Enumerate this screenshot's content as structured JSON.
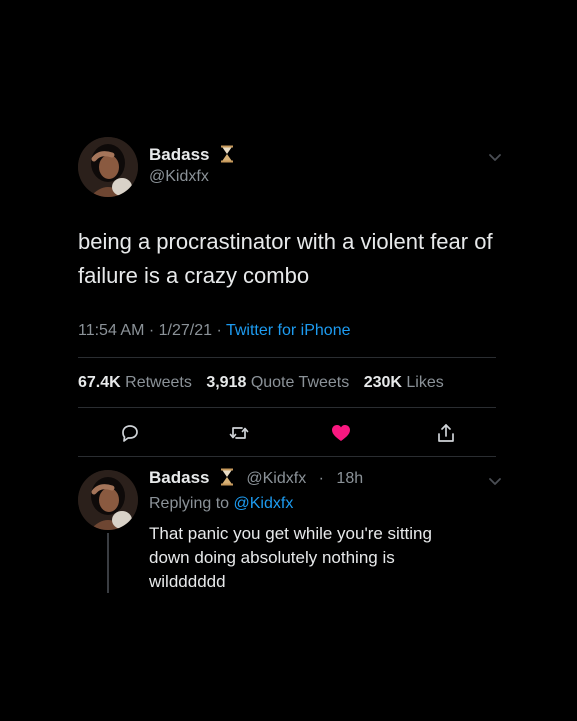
{
  "tweet": {
    "author": {
      "name": "Badass",
      "handle": "@Kidxfx",
      "badge_icon": "hourglass-icon"
    },
    "text": "being a procrastinator with a violent fear of failure is a crazy combo",
    "time": "11:54 AM",
    "date": "1/27/21",
    "separator": "·",
    "source": "Twitter for iPhone",
    "stats": {
      "retweets_count": "67.4K",
      "retweets_label": "Retweets",
      "quotes_count": "3,918",
      "quotes_label": "Quote Tweets",
      "likes_count": "230K",
      "likes_label": "Likes"
    },
    "actions": [
      "reply-icon",
      "retweet-icon",
      "like-icon",
      "share-icon"
    ],
    "liked": true
  },
  "reply": {
    "author": {
      "name": "Badass",
      "handle": "@Kidxfx",
      "badge_icon": "hourglass-icon"
    },
    "separator": "·",
    "age": "18h",
    "replying_label": "Replying to",
    "replying_to": "@Kidxfx",
    "text": "That panic you get while you're sitting\ndown doing absolutely nothing is\nwildddddd"
  },
  "colors": {
    "background": "#000000",
    "text": "#e7e9ea",
    "muted": "#8b9298",
    "link": "#1d9bf0",
    "like": "#f91880",
    "divider": "#2a2d31"
  }
}
